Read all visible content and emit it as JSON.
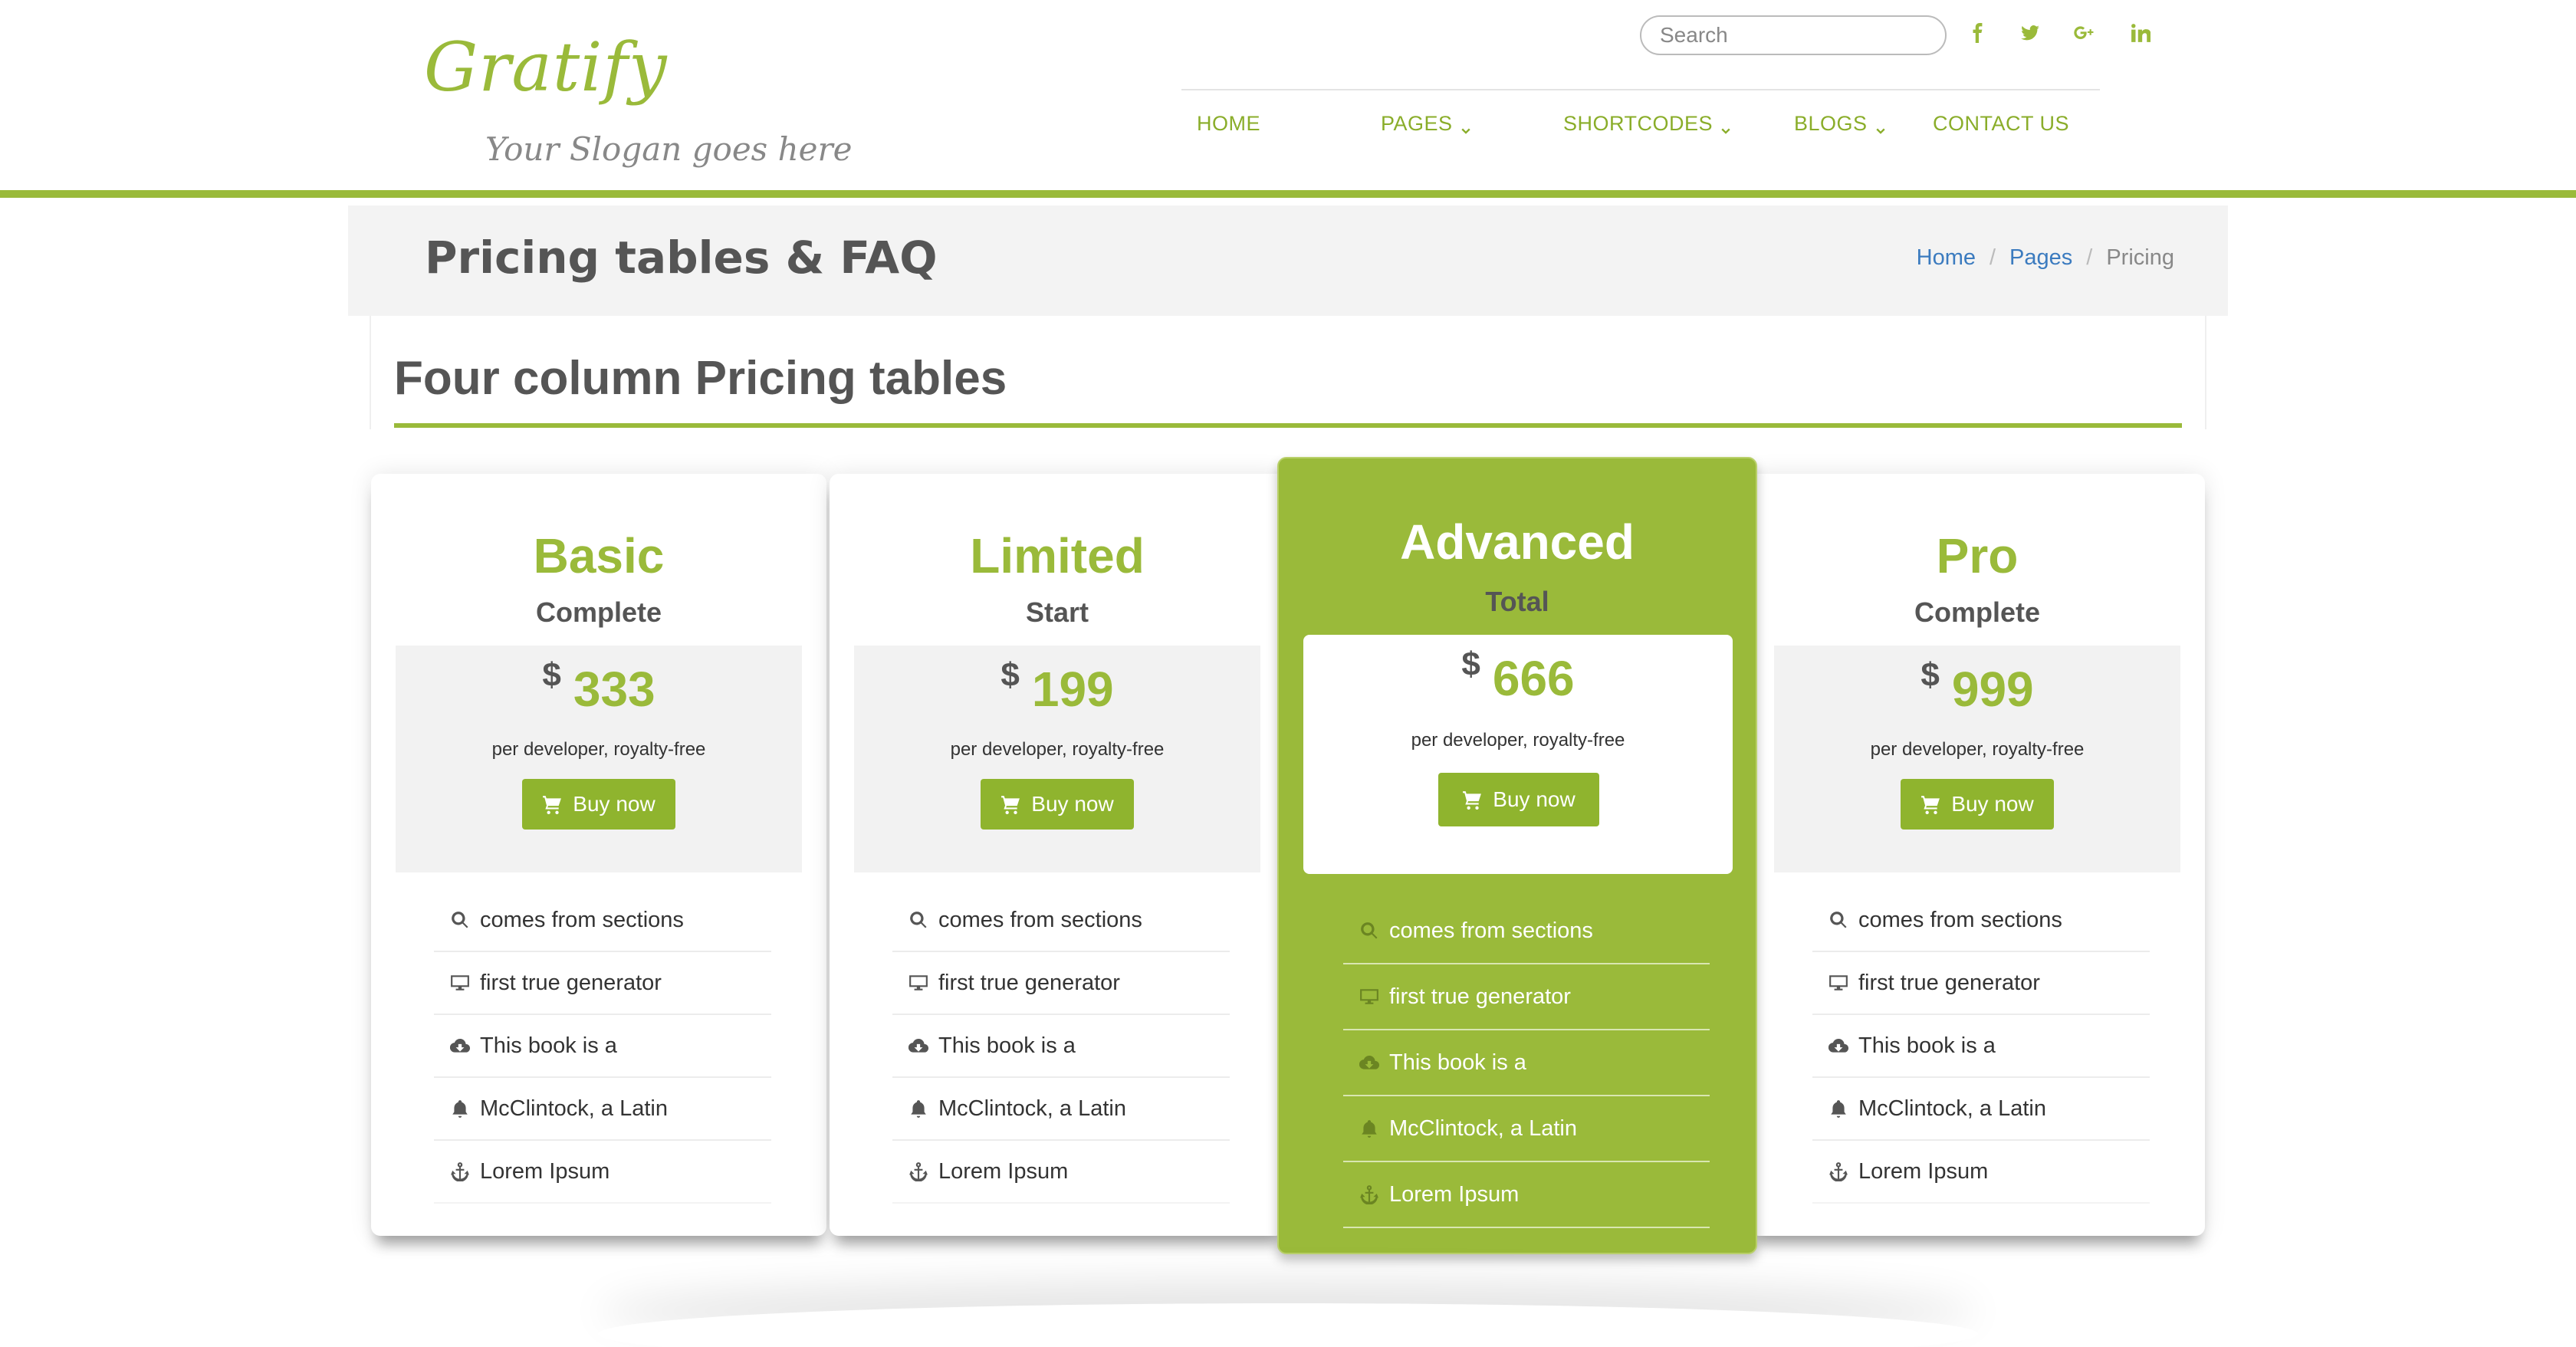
{
  "brand": {
    "logo": "Gratify",
    "slogan": "Your Slogan goes here",
    "accent_color": "#9aba3a",
    "link_color": "#3b7bbf"
  },
  "header": {
    "search_placeholder": "Search",
    "social": [
      {
        "name": "facebook",
        "glyph": "f"
      },
      {
        "name": "twitter",
        "glyph": "twitter-bird"
      },
      {
        "name": "google-plus",
        "glyph": "g+"
      },
      {
        "name": "linkedin",
        "glyph": "in"
      }
    ],
    "nav": [
      {
        "label": "HOME",
        "dropdown": false
      },
      {
        "label": "PAGES",
        "dropdown": true
      },
      {
        "label": "SHORTCODES",
        "dropdown": true
      },
      {
        "label": "BLOGS",
        "dropdown": true
      },
      {
        "label": "CONTACT US",
        "dropdown": false
      }
    ]
  },
  "titlebar": {
    "title": "Pricing tables & FAQ",
    "breadcrumb": {
      "home": "Home",
      "pages": "Pages",
      "current": "Pricing",
      "separator": "/"
    }
  },
  "section": {
    "title": "Four column Pricing tables"
  },
  "plans": [
    {
      "name": "Basic",
      "subtitle": "Complete",
      "currency": "$",
      "price": "333",
      "note": "per developer, royalty-free",
      "button": "Buy now",
      "featured": false,
      "features": [
        {
          "icon": "search-icon",
          "text": "comes from sections"
        },
        {
          "icon": "desktop-icon",
          "text": "first true generator"
        },
        {
          "icon": "cloud-download-icon",
          "text": "This book is a"
        },
        {
          "icon": "bell-icon",
          "text": "McClintock, a Latin"
        },
        {
          "icon": "anchor-icon",
          "text": "Lorem Ipsum"
        }
      ]
    },
    {
      "name": "Limited",
      "subtitle": "Start",
      "currency": "$",
      "price": "199",
      "note": "per developer, royalty-free",
      "button": "Buy now",
      "featured": false,
      "features": [
        {
          "icon": "search-icon",
          "text": "comes from sections"
        },
        {
          "icon": "desktop-icon",
          "text": "first true generator"
        },
        {
          "icon": "cloud-download-icon",
          "text": "This book is a"
        },
        {
          "icon": "bell-icon",
          "text": "McClintock, a Latin"
        },
        {
          "icon": "anchor-icon",
          "text": "Lorem Ipsum"
        }
      ]
    },
    {
      "name": "Advanced",
      "subtitle": "Total",
      "currency": "$",
      "price": "666",
      "note": "per developer, royalty-free",
      "button": "Buy now",
      "featured": true,
      "features": [
        {
          "icon": "search-icon",
          "text": "comes from sections"
        },
        {
          "icon": "desktop-icon",
          "text": "first true generator"
        },
        {
          "icon": "cloud-download-icon",
          "text": "This book is a"
        },
        {
          "icon": "bell-icon",
          "text": "McClintock, a Latin"
        },
        {
          "icon": "anchor-icon",
          "text": "Lorem Ipsum"
        }
      ]
    },
    {
      "name": "Pro",
      "subtitle": "Complete",
      "currency": "$",
      "price": "999",
      "note": "per developer, royalty-free",
      "button": "Buy now",
      "featured": false,
      "features": [
        {
          "icon": "search-icon",
          "text": "comes from sections"
        },
        {
          "icon": "desktop-icon",
          "text": "first true generator"
        },
        {
          "icon": "cloud-download-icon",
          "text": "This book is a"
        },
        {
          "icon": "bell-icon",
          "text": "McClintock, a Latin"
        },
        {
          "icon": "anchor-icon",
          "text": "Lorem Ipsum"
        }
      ]
    }
  ]
}
